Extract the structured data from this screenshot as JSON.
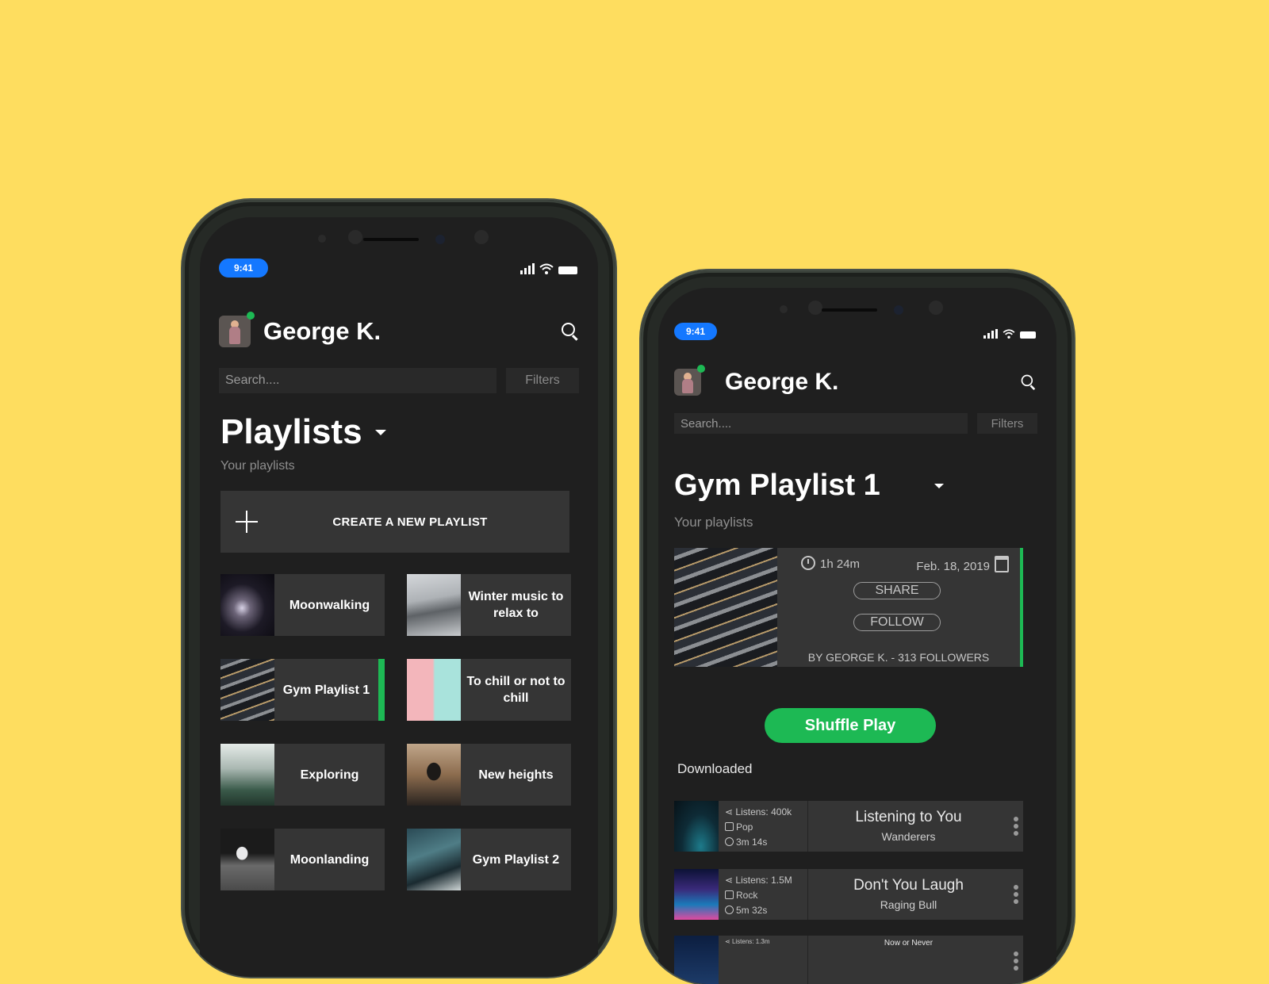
{
  "phone1": {
    "status_time": "9:41",
    "user": {
      "name": "George K."
    },
    "search": {
      "placeholder": "Search....",
      "filters_label": "Filters"
    },
    "title": "Playlists",
    "subtitle": "Your playlists",
    "create_label": "CREATE A NEW PLAYLIST",
    "playlists": [
      {
        "label": "Moonwalking",
        "thumb": "space"
      },
      {
        "label": "Winter music to relax to",
        "thumb": "mountain"
      },
      {
        "label": "Gym Playlist 1",
        "thumb": "gym",
        "active": true
      },
      {
        "label": "To chill or not to chill",
        "thumb": "chill"
      },
      {
        "label": "Exploring",
        "thumb": "forest"
      },
      {
        "label": "New heights",
        "thumb": "heights"
      },
      {
        "label": "Moonlanding",
        "thumb": "moon"
      },
      {
        "label": "Gym Playlist 2",
        "thumb": "gym2"
      }
    ]
  },
  "phone2": {
    "status_time": "9:41",
    "user": {
      "name": "George K."
    },
    "search": {
      "placeholder": "Search....",
      "filters_label": "Filters"
    },
    "title": "Gym Playlist 1",
    "subtitle": "Your playlists",
    "playlist": {
      "duration": "1h 24m",
      "date": "Feb. 18, 2019",
      "share_label": "SHARE",
      "follow_label": "FOLLOW",
      "byline": "BY GEORGE K. - 313 FOLLOWERS"
    },
    "shuffle_label": "Shuffle Play",
    "section_label": "Downloaded",
    "tracks": [
      {
        "listens": "Listens: 400k",
        "genre": "Pop",
        "duration": "3m 14s",
        "title": "Listening to You",
        "artist": "Wanderers"
      },
      {
        "listens": "Listens: 1.5M",
        "genre": "Rock",
        "duration": "5m 32s",
        "title": "Don't You Laugh",
        "artist": "Raging Bull"
      },
      {
        "listens": "Listens: 1.3m",
        "title": "Now or Never"
      }
    ]
  },
  "colors": {
    "background": "#fedd5f",
    "accent": "#1db954",
    "status_pill": "#1478ff",
    "screen": "#1f1f1f",
    "card": "#353535"
  },
  "icons": [
    "search-icon",
    "caret-down-icon",
    "plus-icon",
    "clock-icon",
    "calendar-icon",
    "share-icon",
    "music-icon",
    "more-vertical-icon",
    "signal-icon",
    "wifi-icon",
    "battery-icon"
  ]
}
